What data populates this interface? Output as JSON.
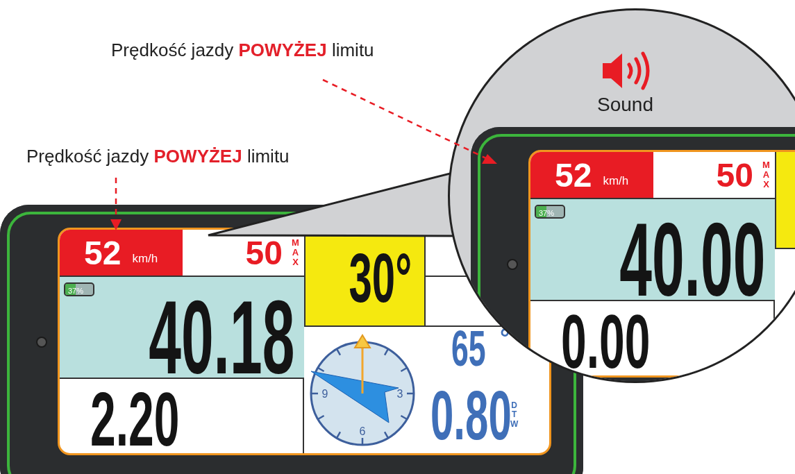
{
  "callouts": [
    {
      "before": "Prędkość jazdy ",
      "highlight": "POWYŻEJ",
      "after": " limitu"
    },
    {
      "before": "Prędkość jazdy ",
      "highlight": "POWYŻEJ",
      "after": " limitu"
    }
  ],
  "main_screen": {
    "speed": {
      "value": "52",
      "unit": "km/h",
      "over_limit": true
    },
    "limit": {
      "value": "50",
      "label": "MAX"
    },
    "battery": {
      "text": "37%",
      "level": 0.37
    },
    "primary_value": "40.18",
    "secondary_value": "2.20",
    "heading": "30°",
    "waypoint": {
      "bearing": "65",
      "degree": "°",
      "distance": "0.80",
      "distance_label": "DTW",
      "compass_marks": [
        "9",
        "3",
        "6"
      ]
    }
  },
  "magnifier": {
    "sound_label": "Sound",
    "screen": {
      "speed": {
        "value": "52",
        "unit": "km/h",
        "over_limit": true
      },
      "limit": {
        "value": "50",
        "label": "MAX"
      },
      "battery": {
        "text": "37%",
        "level": 0.37
      },
      "primary_value": "40.00",
      "secondary_value": "0.00"
    }
  }
}
